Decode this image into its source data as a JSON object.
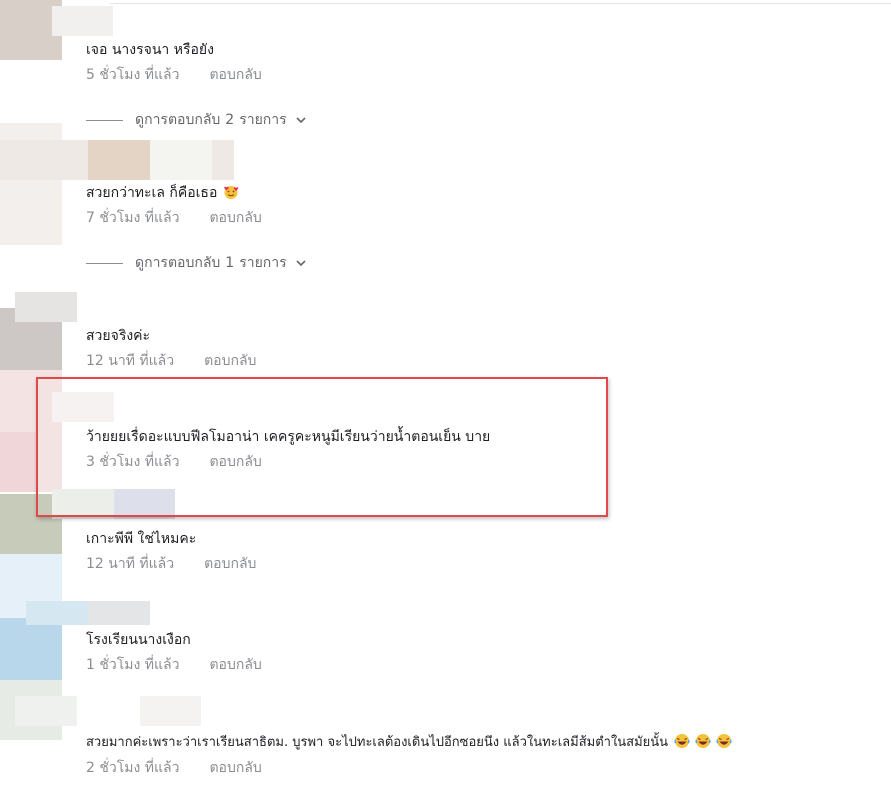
{
  "comments": [
    {
      "text": "เจอ นางรจนา หรือยัง",
      "time": "5 ชั่วโมง ที่แล้ว",
      "reply": "ตอบกลับ"
    },
    {
      "text": "สวยกว่าทะเล ก็คือเธอ",
      "time": "7 ชั่วโมง ที่แล้ว",
      "reply": "ตอบกลับ"
    },
    {
      "text": "สวยจริงค่ะ",
      "time": "12 นาที ที่แล้ว",
      "reply": "ตอบกลับ"
    },
    {
      "text": "ว้ายยยเรื่ดอะแบบฟีลโมอาน่า เคครูคะหนูมีเรียนว่ายน้ำตอนเย็น บาย",
      "time": "3 ชั่วโมง ที่แล้ว",
      "reply": "ตอบกลับ"
    },
    {
      "text": "เกาะพีพี ใช่ไหมคะ",
      "time": "12 นาที ที่แล้ว",
      "reply": "ตอบกลับ"
    },
    {
      "text": "โรงเรียนนางเงือก",
      "time": "1 ชั่วโมง ที่แล้ว",
      "reply": "ตอบกลับ"
    },
    {
      "text": "สวยมากค่ะเพราะว่าเราเรียนสาธิตม. บูรพา จะไปทะเลต้องเดินไปอีกซอยนึง แล้วในทะเลมีส้มตำในสมัยนั้น",
      "time": "2 ชั่วโมง ที่แล้ว",
      "reply": "ตอบกลับ"
    }
  ],
  "view_replies": [
    {
      "prefix": "ดูการตอบกลับ",
      "count": "2",
      "suffix": "รายการ"
    },
    {
      "prefix": "ดูการตอบกลับ",
      "count": "1",
      "suffix": "รายการ"
    }
  ],
  "icons": {
    "chevron": "chevron-down-icon",
    "heart_face": "smiling-face-with-hearts-emoji",
    "laughing": "laughing-face-emoji"
  },
  "colors": {
    "highlight_border": "#e0484a",
    "meta_text": "#8a8d91",
    "body_text": "#1c1e21"
  }
}
